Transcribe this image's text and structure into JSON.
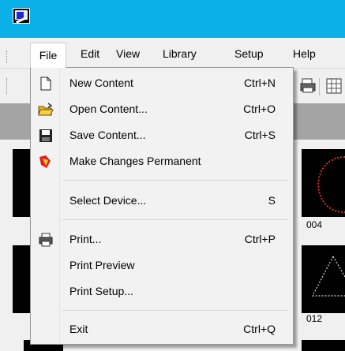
{
  "menubar": {
    "items": [
      "File",
      "Edit",
      "View",
      "Library",
      "Setup",
      "Help"
    ]
  },
  "file_menu": {
    "items": [
      {
        "label": "New Content",
        "shortcut": "Ctrl+N",
        "icon": "new-document-icon"
      },
      {
        "label": "Open Content...",
        "shortcut": "Ctrl+O",
        "icon": "open-folder-icon"
      },
      {
        "label": "Save Content...",
        "shortcut": "Ctrl+S",
        "icon": "floppy-disk-icon"
      },
      {
        "label": "Make Changes Permanent",
        "shortcut": "",
        "icon": "make-permanent-icon"
      },
      {
        "label": "Select Device...",
        "shortcut": "S",
        "icon": ""
      },
      {
        "label": "Print...",
        "shortcut": "Ctrl+P",
        "icon": "printer-icon"
      },
      {
        "label": "Print Preview",
        "shortcut": "",
        "icon": ""
      },
      {
        "label": "Print Setup...",
        "shortcut": "",
        "icon": ""
      },
      {
        "label": "Exit",
        "shortcut": "Ctrl+Q",
        "icon": ""
      }
    ]
  },
  "thumbnails": {
    "labels": [
      "004",
      "012"
    ]
  },
  "colors": {
    "titlebar": "#0bb0e6",
    "menu_background": "#f2f2f2",
    "thumbnail_background": "#000000",
    "thumbnail_shape": "#e03030"
  }
}
